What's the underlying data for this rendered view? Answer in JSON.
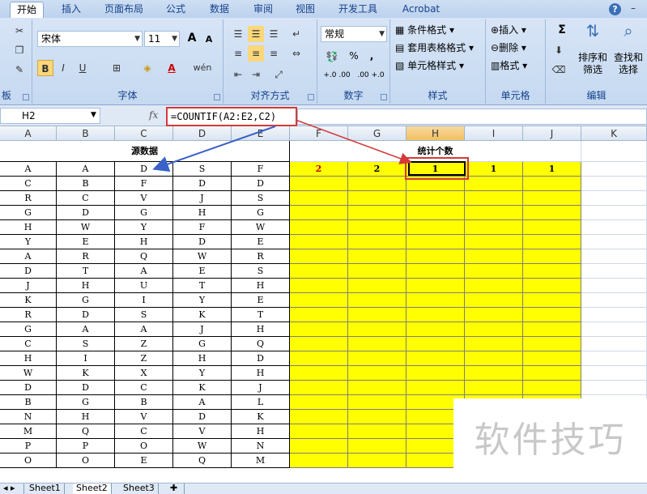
{
  "ribbon": {
    "tabs": [
      "开始",
      "插入",
      "页面布局",
      "公式",
      "数据",
      "审阅",
      "视图",
      "开发工具",
      "Acrobat"
    ],
    "active_tab": "开始",
    "font": {
      "name": "宋体",
      "size": "11",
      "label": "字体",
      "grow": "A",
      "shrink": "A"
    },
    "clipboard_label": "板",
    "alignment_label": "对齐方式",
    "number": {
      "format": "常规",
      "label": "数字",
      "percent": "%",
      "comma": ",",
      "inc": "+.0 .00",
      "dec": ".00 +.0"
    },
    "styles": {
      "conditional": "条件格式",
      "table": "套用表格格式",
      "cell": "单元格样式",
      "label": "样式"
    },
    "cells": {
      "insert": "插入",
      "delete": "删除",
      "format": "格式",
      "label": "单元格"
    },
    "editing": {
      "sort": "排序和\n筛选",
      "find": "查找和\n选择",
      "label": "编辑",
      "sigma": "Σ"
    }
  },
  "formula_bar": {
    "name_box": "H2",
    "fx": "fx",
    "formula": "=COUNTIF(A2:E2,C2)"
  },
  "columns": [
    "A",
    "B",
    "C",
    "D",
    "E",
    "F",
    "G",
    "H",
    "I",
    "J",
    "K"
  ],
  "selected_column": "H",
  "headers": {
    "source": "源数据",
    "count": "统计个数"
  },
  "source_rows": [
    [
      "A",
      "A",
      "D",
      "S",
      "F"
    ],
    [
      "C",
      "B",
      "F",
      "D",
      "D"
    ],
    [
      "R",
      "C",
      "V",
      "J",
      "S"
    ],
    [
      "G",
      "D",
      "G",
      "H",
      "G"
    ],
    [
      "H",
      "W",
      "Y",
      "F",
      "W"
    ],
    [
      "Y",
      "E",
      "H",
      "D",
      "E"
    ],
    [
      "A",
      "R",
      "Q",
      "W",
      "R"
    ],
    [
      "D",
      "T",
      "A",
      "E",
      "S"
    ],
    [
      "J",
      "H",
      "U",
      "T",
      "H"
    ],
    [
      "K",
      "G",
      "I",
      "Y",
      "E"
    ],
    [
      "R",
      "D",
      "S",
      "K",
      "T"
    ],
    [
      "G",
      "A",
      "A",
      "J",
      "H"
    ],
    [
      "C",
      "S",
      "Z",
      "G",
      "Q"
    ],
    [
      "H",
      "I",
      "Z",
      "H",
      "D"
    ],
    [
      "W",
      "K",
      "X",
      "Y",
      "H"
    ],
    [
      "D",
      "D",
      "C",
      "K",
      "J"
    ],
    [
      "B",
      "G",
      "B",
      "A",
      "L"
    ],
    [
      "N",
      "H",
      "V",
      "D",
      "K"
    ],
    [
      "M",
      "Q",
      "C",
      "V",
      "H"
    ],
    [
      "P",
      "P",
      "O",
      "W",
      "N"
    ],
    [
      "O",
      "O",
      "E",
      "Q",
      "M"
    ]
  ],
  "count_row": [
    "2",
    "2",
    "1",
    "1",
    "1"
  ],
  "sheets": [
    "Sheet1",
    "Sheet2",
    "Sheet3"
  ],
  "active_sheet": "Sheet2",
  "watermark": "软件技巧",
  "colors": {
    "highlight": "#ffff00",
    "annotation_red": "#d43a3a",
    "arrow_blue": "#3a62c8"
  }
}
